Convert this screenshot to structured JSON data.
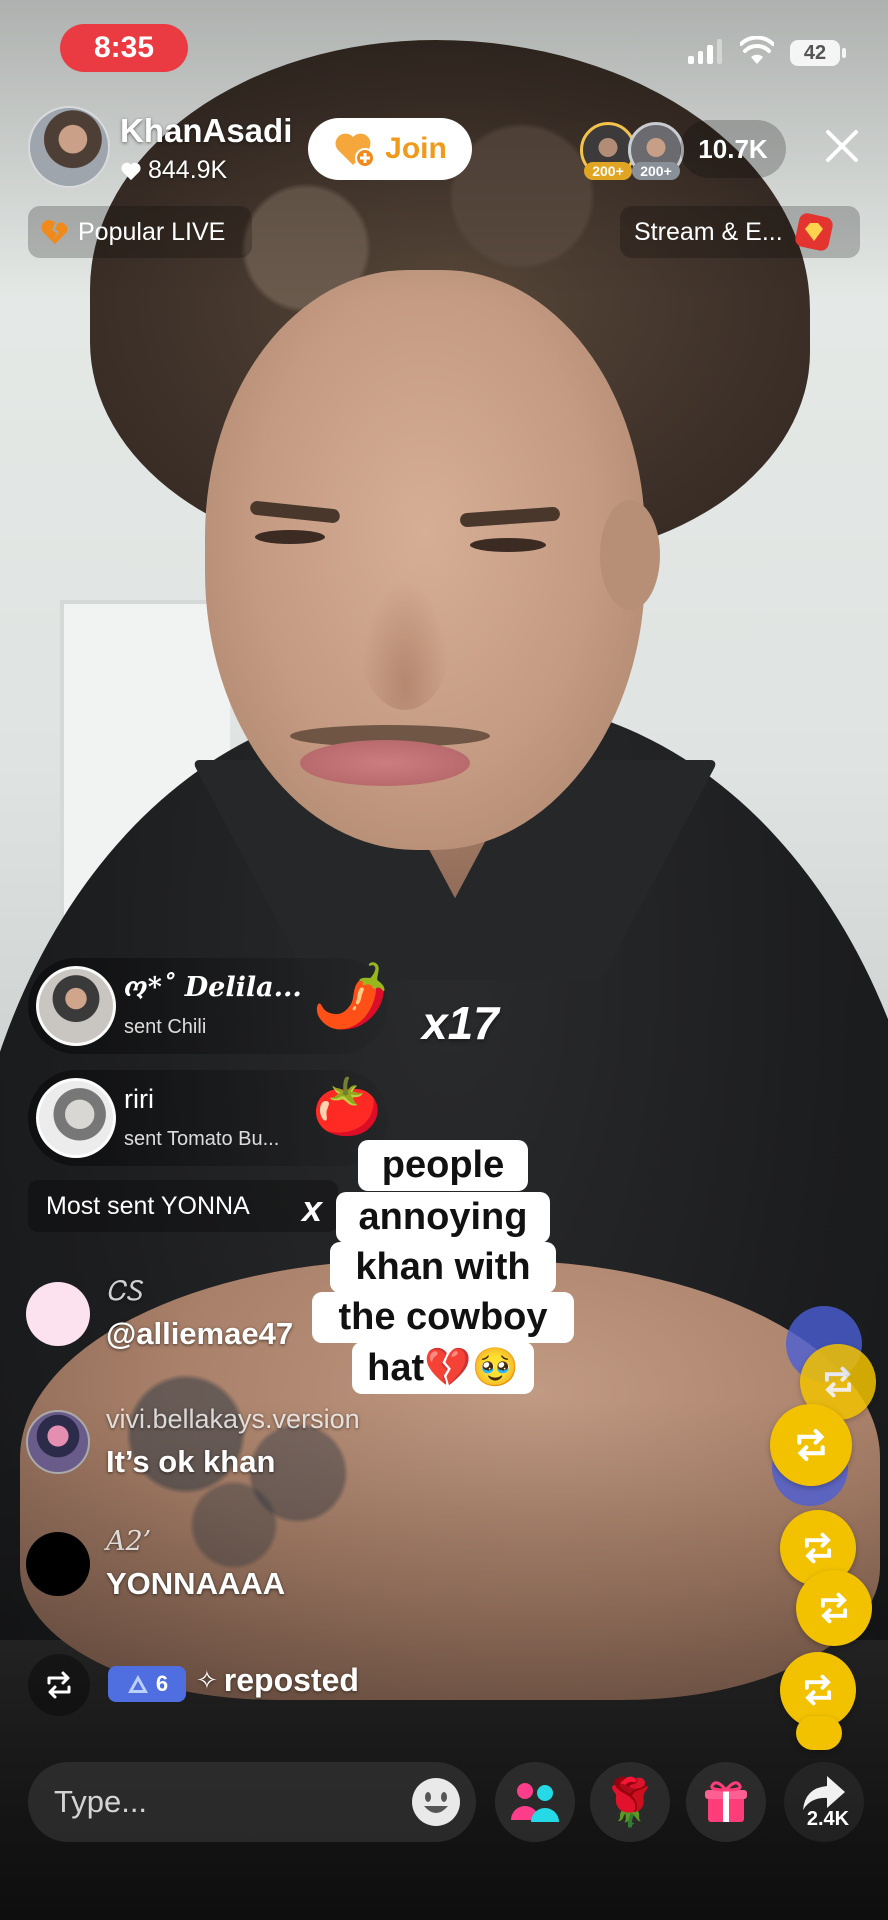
{
  "status_bar": {
    "time": "8:35",
    "battery": "42"
  },
  "host": {
    "name": "KhanAsadi",
    "likes": "844.9K",
    "join_label": "Join"
  },
  "viewers": {
    "rank_1": "200+",
    "rank_2": "200+",
    "count": "10.7K"
  },
  "pills": {
    "popular": "Popular LIVE",
    "stream": "Stream & E..."
  },
  "gifts": [
    {
      "user": "ო*˚ 𝑫𝒆𝒍𝒊𝒍𝒂...",
      "action": "sent Chili",
      "emoji": "🌶️"
    },
    {
      "user": "riri",
      "action": "sent Tomato Bu...",
      "emoji": "🍅"
    }
  ],
  "combo": "x17",
  "most_sent": {
    "label": "Most sent YONNA",
    "x": "x"
  },
  "caption": [
    "people",
    "annoying",
    "khan with",
    "the cowboy",
    "hat💔🥹"
  ],
  "chat": [
    {
      "name": "ᏟᏚ",
      "message": "@alliemae47"
    },
    {
      "name": "vivi.bellakays.version",
      "message": "It’s ok khan"
    },
    {
      "name": "A2’",
      "message": "YONNAAAA"
    }
  ],
  "repost": {
    "level": "6",
    "text": "reposted"
  },
  "bottom": {
    "placeholder": "Type...",
    "share_count": "2.4K"
  },
  "colors": {
    "accent_red": "#ea3a42",
    "join_orange": "#f09a1b",
    "repost_yellow": "#f2c200",
    "badge_blue": "#4f6ee0"
  },
  "icons": [
    "heart-icon",
    "close-icon",
    "gem-icon",
    "repost-icon",
    "emoji-icon",
    "people-icon",
    "rose-icon",
    "gift-icon",
    "share-icon"
  ]
}
